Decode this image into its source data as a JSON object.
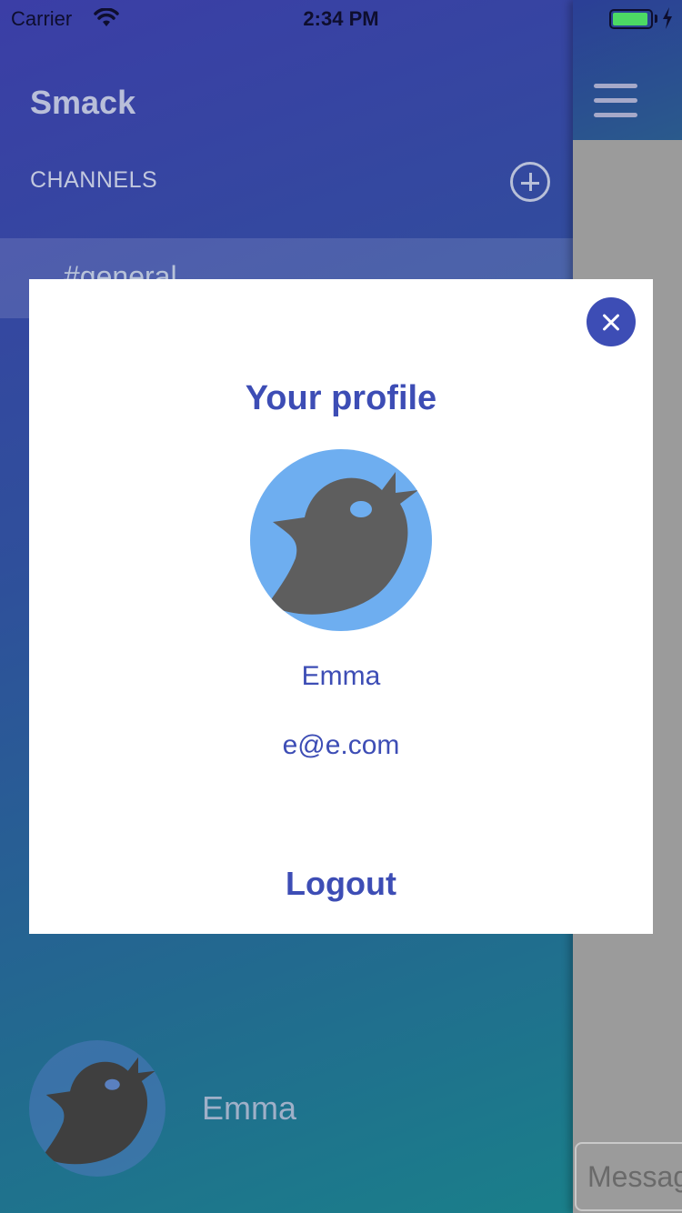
{
  "status_bar": {
    "carrier": "Carrier",
    "time": "2:34 PM"
  },
  "sidebar": {
    "app_title": "Smack",
    "channels_label": "CHANNELS",
    "channels": [
      {
        "name": "#general"
      }
    ],
    "user": {
      "name": "Emma",
      "avatar": "bird-icon"
    }
  },
  "main": {
    "message_placeholder": "Message"
  },
  "profile_modal": {
    "title": "Your profile",
    "name": "Emma",
    "email": "e@e.com",
    "logout_label": "Logout",
    "avatar": "bird-icon"
  },
  "colors": {
    "accent": "#3d4db5",
    "avatar_bg": "#6eaef0",
    "battery": "#4cd964"
  }
}
